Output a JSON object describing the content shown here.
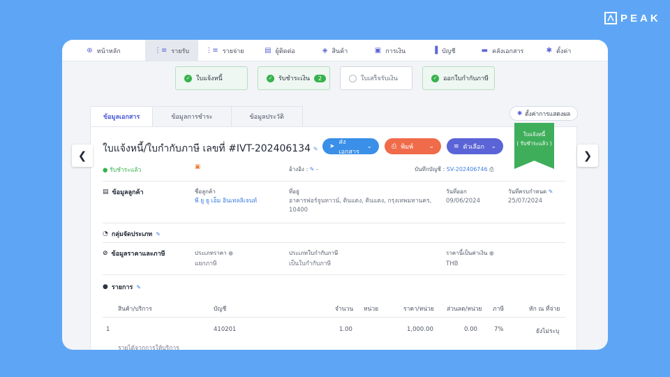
{
  "brand": {
    "logo_text": "PEAK"
  },
  "nav": [
    {
      "label": "หน้าหลัก",
      "icon": "home-icon",
      "glyph": "⊕"
    },
    {
      "label": "รายรับ",
      "icon": "list-icon",
      "glyph": "⋮≡",
      "active": true
    },
    {
      "label": "รายจ่าย",
      "icon": "list-icon",
      "glyph": "⋮≡"
    },
    {
      "label": "ผู้ติดต่อ",
      "icon": "contact-icon",
      "glyph": "▤"
    },
    {
      "label": "สินค้า",
      "icon": "box-icon",
      "glyph": "◈"
    },
    {
      "label": "การเงิน",
      "icon": "money-icon",
      "glyph": "▣"
    },
    {
      "label": "บัญชี",
      "icon": "book-icon",
      "glyph": "▐"
    },
    {
      "label": "คลังเอกสาร",
      "icon": "folder-icon",
      "glyph": "▬"
    },
    {
      "label": "ตั้งค่า",
      "icon": "gear-icon",
      "glyph": "✱"
    }
  ],
  "steps": [
    {
      "label": "ใบแจ้งหนี้",
      "done": true
    },
    {
      "label": "รับชำระเงิน",
      "done": true,
      "badge": "2"
    },
    {
      "label": "ใบเสร็จรับเงิน",
      "done": false
    },
    {
      "label": "ออกใบกำกับภาษี",
      "done": true
    }
  ],
  "tabs": [
    "ข้อมูลเอกสาร",
    "ข้อมูลการชำระ",
    "ข้อมูลประวัติ"
  ],
  "display_settings": "ตั้งค่าการแสดงผล",
  "doc": {
    "title": "ใบแจ้งหนี้/ใบกำกับภาษี เลขที่ #IVT-202406134",
    "send_btn": "ส่งเอกสาร",
    "print_btn": "พิมพ์",
    "options_btn": "ตัวเลือก",
    "ribbon_line1": "ใบแจ้งหนี้",
    "ribbon_line2": "( รับชำระแล้ว )",
    "status": "รับชำระแล้ว",
    "reference_label": "อ้างอิง :",
    "reference_value": "-",
    "journal_label": "บันทึกบัญชี :",
    "journal_value": "SV-202406746"
  },
  "customer": {
    "section": "ข้อมูลลูกค้า",
    "name_label": "ชื่อลูกค้า",
    "name": "พี ยู ยู เอ็ม อินเทลลิเจนท์",
    "address_label": "ที่อยู่",
    "address_line1": "อาคารฟอร์จูนทาวน์, ดินแดง, ดินแดง, กรุงเทพมหานคร,",
    "address_line2": "10400",
    "issue_label": "วันที่ออก",
    "issue_date": "09/06/2024",
    "due_label": "วันที่ครบกำหนด",
    "due_date": "25/07/2024"
  },
  "classification": {
    "section": "กลุ่มจัดประเภท"
  },
  "pricing": {
    "section": "ข้อมูลราคาและภาษี",
    "price_type_label": "ประเภทราคา",
    "price_type": "แยกภาษี",
    "tax_type_label": "ประเภทใบกำกับภาษี",
    "tax_type": "เป็นใบกำกับภาษี",
    "currency_label": "ราคานี้เป็นค่าเงิน",
    "currency": "THB"
  },
  "items": {
    "section": "รายการ",
    "headers": [
      "สินค้า/บริการ",
      "บัญชี",
      "จำนวน",
      "หน่วย",
      "ราคา/หน่วย",
      "ส่วนลด/หน่วย",
      "ภาษี",
      "หัก ณ ที่จ่าย"
    ],
    "rows": [
      {
        "no": "1",
        "account": "410201",
        "qty": "1.00",
        "unit": "",
        "price": "1,000.00",
        "discount": "0.00",
        "vat": "7%",
        "wht": "ยังไม่ระบุ",
        "desc": "รายได้จากการให้บริการ"
      }
    ]
  }
}
